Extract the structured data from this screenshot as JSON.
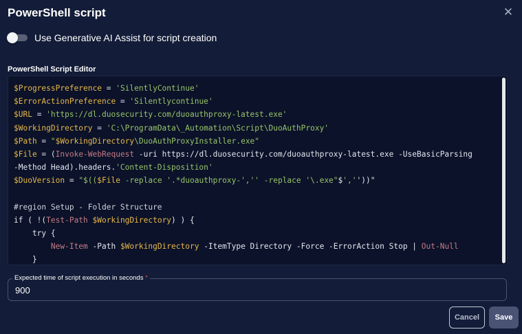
{
  "dialog": {
    "title": "PowerShell script",
    "close_icon": "close-icon"
  },
  "ai_assist": {
    "label": "Use Generative AI Assist for script creation",
    "enabled": false
  },
  "editor": {
    "label": "PowerShell Script Editor",
    "lines": [
      "$ProgressPreference = 'SilentlyContinue'",
      "$ErrorActionPreference = 'Silentlycontinue'",
      "$URL = 'https://dl.duosecurity.com/duoauthproxy-latest.exe'",
      "$WorkingDirectory = 'C:\\ProgramData\\_Automation\\Script\\DuoAuthProxy'",
      "$Path = \"$WorkingDirectory\\DuoAuthProxyInstaller.exe\"",
      "$File = (Invoke-WebRequest -uri https://dl.duosecurity.com/duoauthproxy-latest.exe -UseBasicParsing -Method Head).headers.'Content-Disposition'",
      "$DuoVersion = \"$(($File -replace '.*duoauthproxy-','' -replace '\\.exe\"$',''))\"",
      "",
      "#region Setup - Folder Structure",
      "if ( !(Test-Path $WorkingDirectory) ) {",
      "    try {",
      "        New-Item -Path $WorkingDirectory -ItemType Directory -Force -ErrorAction Stop | Out-Null",
      "    }"
    ]
  },
  "execution_time": {
    "label": "Expected time of script execution in seconds",
    "required_marker": "*",
    "value": "900"
  },
  "actions": {
    "cancel_label": "Cancel",
    "save_label": "Save"
  },
  "colors": {
    "background": "#131c38",
    "editor_background": "#0b1229",
    "variable": "#e8b84a",
    "string": "#98c46a",
    "command": "#c57b86",
    "save_button": "#4b5375"
  }
}
